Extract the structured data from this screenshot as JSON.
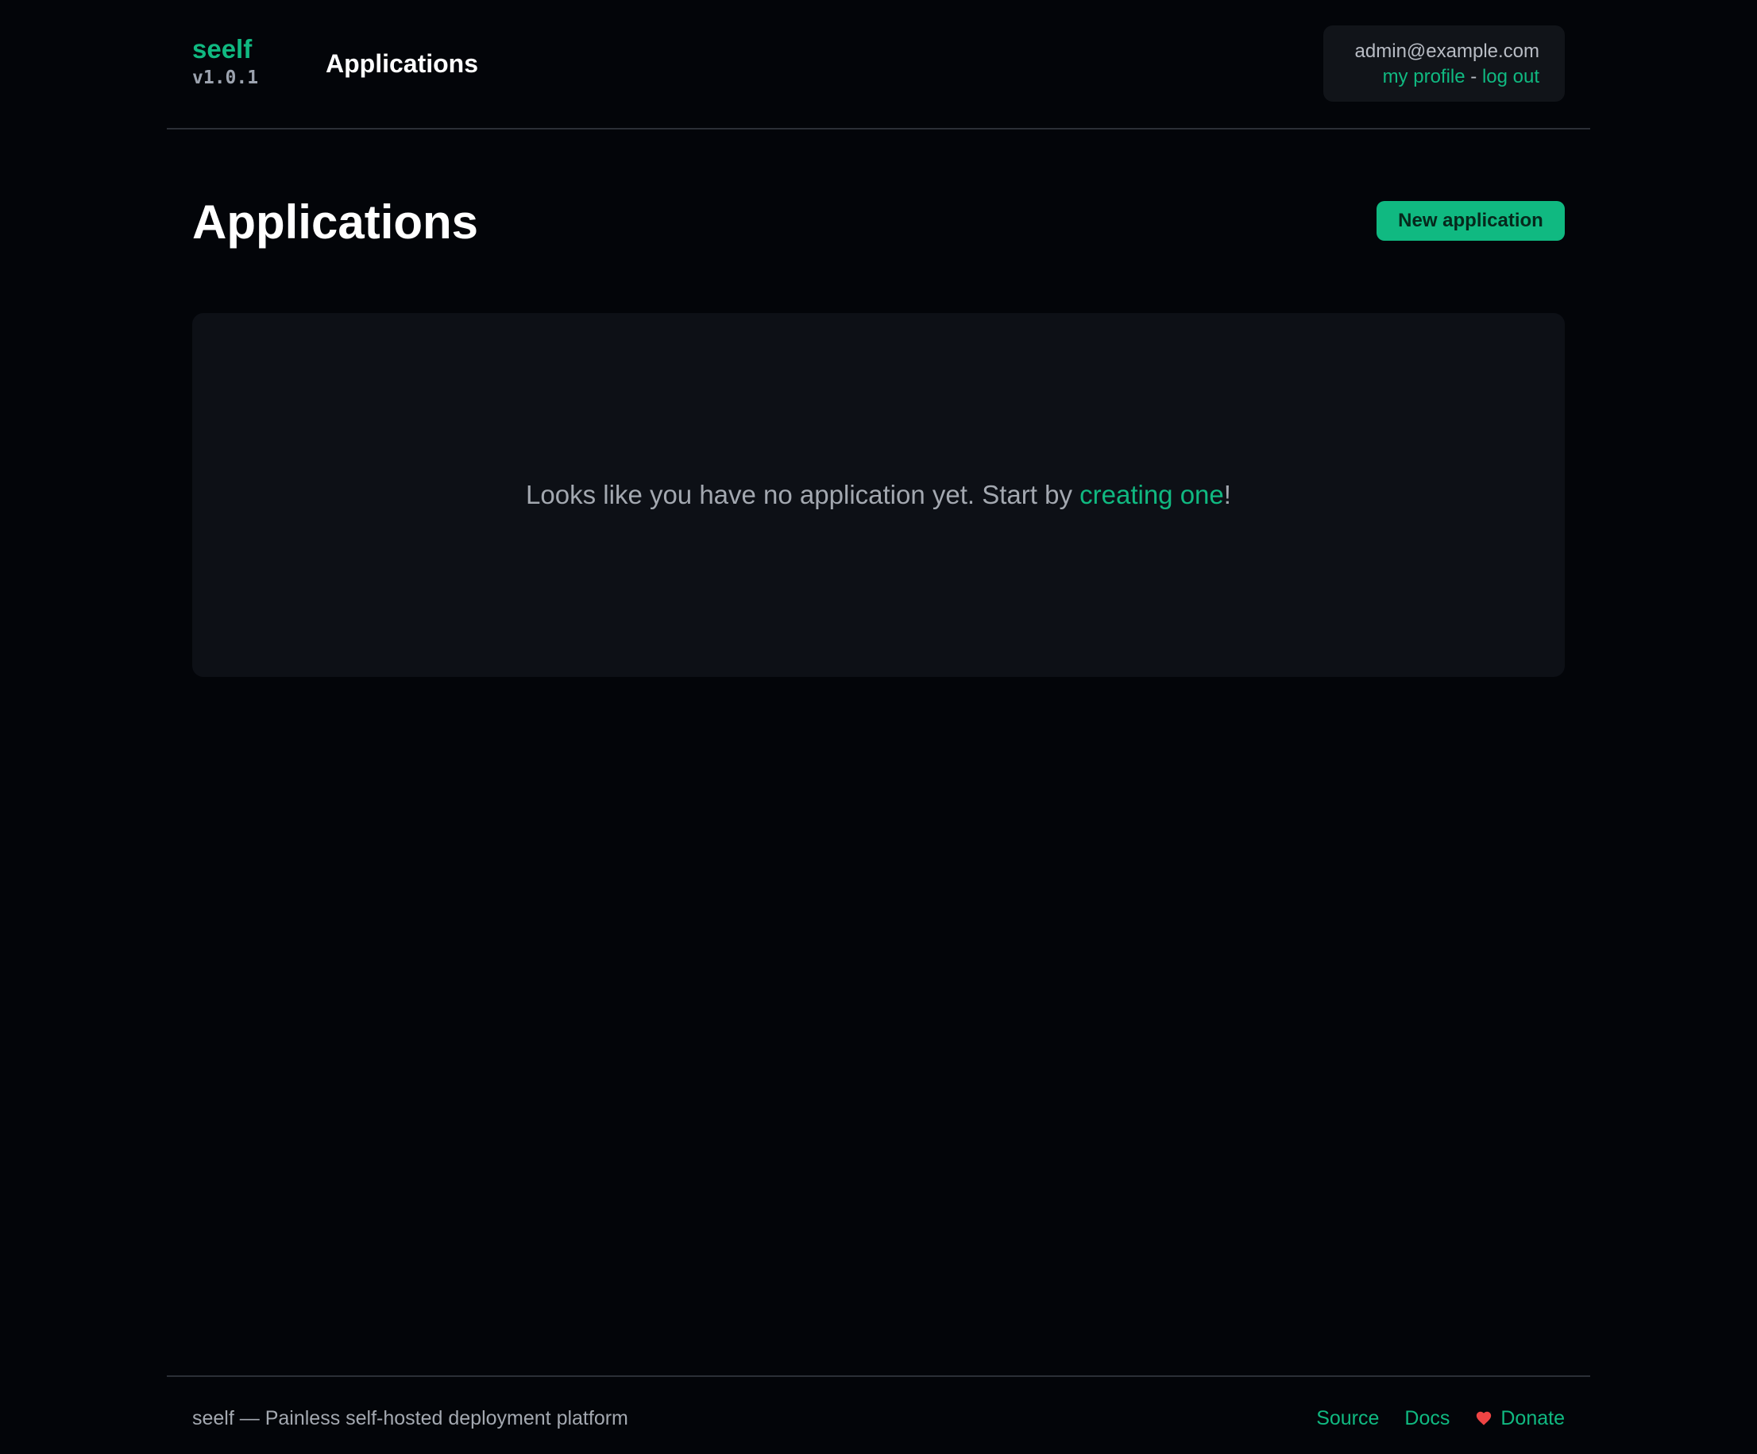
{
  "header": {
    "brand": "seelf",
    "version": "v1.0.1",
    "nav_applications": "Applications",
    "user": {
      "email": "admin@example.com",
      "profile_link": "my profile",
      "separator": "-",
      "logout_link": "log out"
    }
  },
  "main": {
    "title": "Applications",
    "new_button": "New application",
    "empty": {
      "text_before": "Looks like you have no application yet. Start by ",
      "link": "creating one",
      "text_after": "!"
    }
  },
  "footer": {
    "tagline": "seelf — Painless self-hosted deployment platform",
    "links": {
      "source": "Source",
      "docs": "Docs",
      "donate": "Donate"
    }
  },
  "colors": {
    "accent": "#10b981",
    "background": "#030509",
    "card": "#0d1016",
    "heart": "#ef4444"
  },
  "icons": {
    "donate": "heart-icon"
  }
}
